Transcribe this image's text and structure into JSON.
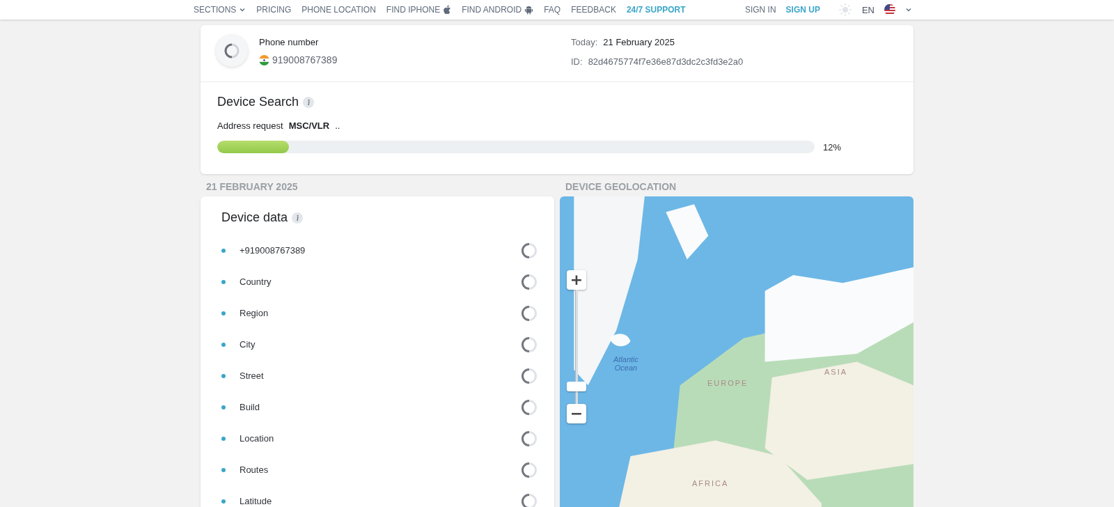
{
  "nav": {
    "items": [
      {
        "label": "SECTIONS",
        "kind": "dropdown"
      },
      {
        "label": "PRICING",
        "kind": "link"
      },
      {
        "label": "PHONE LOCATION",
        "kind": "link"
      },
      {
        "label": "FIND IPHONE",
        "kind": "apple"
      },
      {
        "label": "FIND ANDROID",
        "kind": "android"
      },
      {
        "label": "FAQ",
        "kind": "link"
      },
      {
        "label": "FEEDBACK",
        "kind": "link"
      },
      {
        "label": "24/7 SUPPORT",
        "kind": "accent"
      }
    ],
    "sign_in": "SIGN IN",
    "sign_up": "SIGN UP",
    "language": "EN"
  },
  "summary": {
    "phone_label": "Phone number",
    "phone": "919008767389",
    "today_label": "Today:",
    "today": "21 February 2025",
    "id_label": "ID:",
    "id": "82d4675774f7e36e87d3dc2c3fd3e2a0"
  },
  "search": {
    "title": "Device Search",
    "request_label": "Address request",
    "request_value": "MSC/VLR",
    "request_dots": "..",
    "level": 0.12,
    "percent": "12%"
  },
  "date_heading": "21 FEBRUARY 2025",
  "geo_heading": "DEVICE GEOLOCATION",
  "device_data": {
    "title": "Device data",
    "items": [
      "+919008767389",
      "Country",
      "Region",
      "City",
      "Street",
      "Build",
      "Location",
      "Routes",
      "Latitude"
    ]
  },
  "map": {
    "zoom_in": "+",
    "zoom_out": "−",
    "level": 0.12,
    "labels": [
      {
        "text": "Atlantic Ocean",
        "kind": "ocean"
      },
      {
        "text": "EUROPE",
        "kind": "region"
      },
      {
        "text": "ASIA",
        "kind": "region"
      },
      {
        "text": "AFRICA",
        "kind": "region"
      }
    ]
  }
}
